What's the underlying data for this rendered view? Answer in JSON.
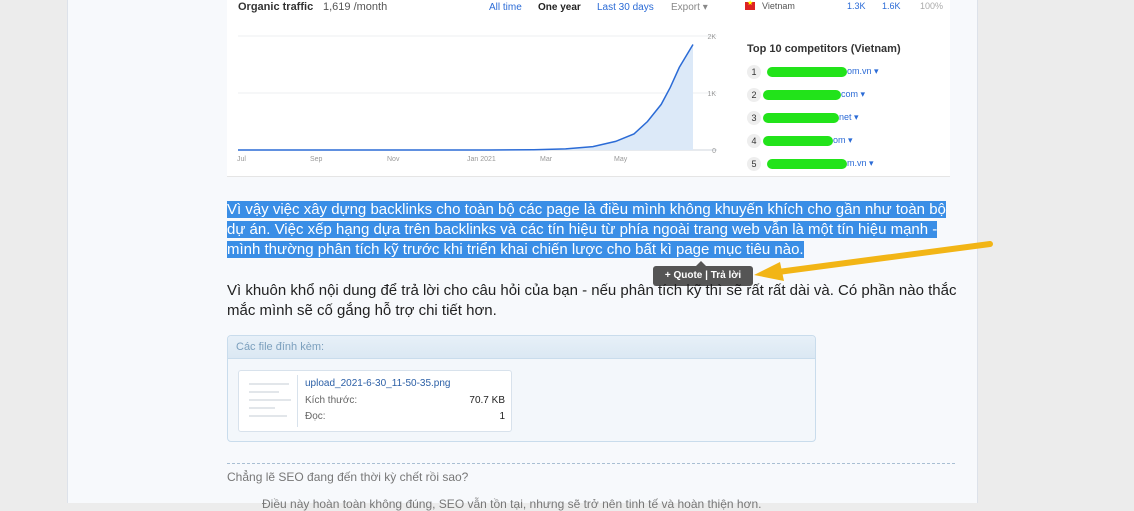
{
  "screenshot": {
    "traffic_title": "Organic traffic",
    "traffic_value": "1,619 /month",
    "ranges": [
      "All time",
      "One year",
      "Last 30 days"
    ],
    "active_range": "One year",
    "export_label": "Export",
    "chart_data": {
      "type": "area",
      "x": [
        "Jul",
        "Sep",
        "Nov",
        "Jan 2021",
        "Mar",
        "May"
      ],
      "y_ticks": [
        "2K",
        "1K",
        "0"
      ],
      "ylim": [
        0,
        2000
      ],
      "series": [
        {
          "values": [
            {
              "t": 0,
              "v": 0
            },
            {
              "t": 0.55,
              "v": 0
            },
            {
              "t": 0.65,
              "v": 5
            },
            {
              "t": 0.72,
              "v": 20
            },
            {
              "t": 0.78,
              "v": 60
            },
            {
              "t": 0.83,
              "v": 150
            },
            {
              "t": 0.87,
              "v": 280
            },
            {
              "t": 0.9,
              "v": 500
            },
            {
              "t": 0.93,
              "v": 800
            },
            {
              "t": 0.95,
              "v": 1100
            },
            {
              "t": 0.97,
              "v": 1450
            },
            {
              "t": 1.0,
              "v": 1850
            }
          ]
        }
      ],
      "grid": true,
      "color": "#2b6bd6"
    },
    "country": {
      "name": "Vietnam",
      "v1": "1.3K",
      "v2": "1.6K",
      "pct": "100%"
    },
    "competitors_title": "Top 10 competitors (Vietnam)",
    "competitors": [
      {
        "num": "1",
        "domain": "om.vn ▾"
      },
      {
        "num": "2",
        "domain": "com ▾"
      },
      {
        "num": "3",
        "domain": "net ▾"
      },
      {
        "num": "4",
        "domain": "om ▾"
      },
      {
        "num": "5",
        "domain": "m.vn ▾"
      }
    ]
  },
  "selected_paragraph": "Vì vậy việc xây dựng backlinks cho toàn bộ các page là điều mình không khuyến khích cho gần như toàn bộ dự án. Việc xếp hạng dựa trên backlinks và các tín hiệu từ phía ngoài trang web vẫn là một tín hiệu mạnh - mình thường phân tích kỹ trước khi triển khai chiến lược cho bất kì page mục tiêu nào.",
  "tooltip_label": "+ Quote | Trả lời",
  "paragraph": "Vì khuôn khổ nội dung để trả lời cho câu hỏi của bạn - nếu phân tích kỹ thì sẽ rất rất dài và. Có phần nào thắc mắc mình sẽ cố gắng hỗ trợ chi tiết hơn.",
  "attachments": {
    "header": "Các file đính kèm:",
    "file_name": "upload_2021-6-30_11-50-35.png",
    "size_label": "Kích thước:",
    "size_value": "70.7 KB",
    "views_label": "Đọc:",
    "views_value": "1"
  },
  "next_thread_title": "Chẳng lẽ SEO đang đến thời kỳ chết rồi sao?",
  "next_thread_line": "Điều này hoàn toàn không đúng, SEO vẫn tồn tại, nhưng sẽ trở nên tinh tế và hoàn thiện hơn."
}
